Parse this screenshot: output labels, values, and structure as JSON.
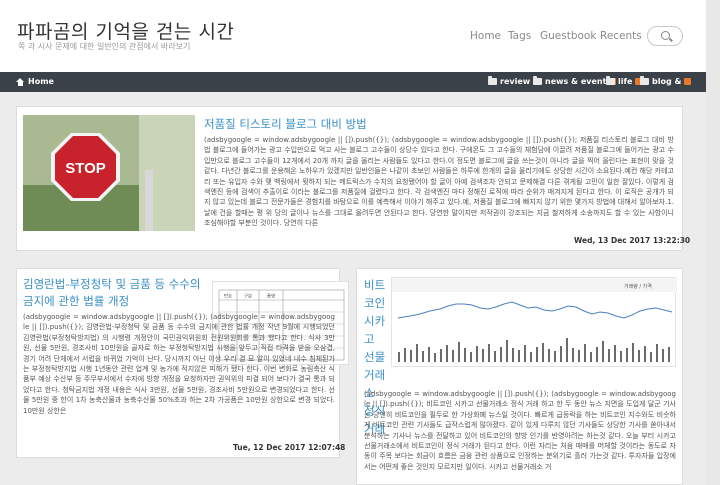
{
  "site": {
    "title": "파파곰의 기억을 걷는 시간",
    "subtitle": "쪽 과 시사 문제에 대한 일반인의 관점에서 바라보기"
  },
  "topnav": {
    "items": [
      "Home",
      "Tags",
      "Guestbook",
      "Recents"
    ]
  },
  "catbar": {
    "home": "Home",
    "categories": [
      "review",
      "news & event",
      "life",
      "blog &"
    ]
  },
  "posts": [
    {
      "title": "저품질 티스토리 블로그 대비 방법",
      "body": "(adsbygoogle = window.adsbygoogle || []).push({}); (adsbygoogle = window.adsbygoogle || []).push({}); 저품질 티스토리 블로그 대비 방법 블로그에 들어가는 광고 수입만으로 먹고 사는 블로그 고수들이 상당수 있다고 한다. 구에몬도 그 고수들의 체험담에 이끌려 저품질 블로그에 들어가는 광고 수입만으로 블로그 고수들이 12개에서 20개 까지 글을 올리는 사람들도 있다고 한다.이 정도면 블로그에 글을 쓰는것이 아니라 글을 찍어 올린다는 표현이 맞을 것 같다. 다년간 블로그를 운용해온 노하우가 있겠지만 일반인들은 나같이 초보인 사람들은 하루에 한개의 글을 올리기에도 상당한 시간이 소요된다.예컨 해당 카테고리 또는 유입자 수와 맺 백링에서 뭣하지 되는 메트릭스가 수치의 요청됐어야 할 글이 아예 검색조차 안되고 문제해결 다른 겪게될 고민이 일한 잘있다. 이렇게 검색엔진 등에 검색이 추출이로 이라는 블로그를 저품질에 걸렸다고 한다. 각 검색엔진 마다 정해진 로직에 따라 순위가 매겨지게 된다고 한다. 이 로직은 공개가 되지 않고 있는데 블로그 전문가들은 경험치를 바탕으로 이를 예측해서 이야기 해주고 있다.예, 저품질 블로그에 빠지지 않기 위한 몇가지 방법에 대해서 알아보자.1. 날에 건을 할때는 평 위 당의 글이나 뉴스를 그대로 올려두면 안된다고 한다. 당연한 말이지만 저작권이 강조되는 지금 철저하게 소송까지도 할 수 있는 사항이니 조심해야할 부분인 것이다. 당연히 다른",
      "date": "Wed, 13 Dec 2017 13:22:30"
    },
    {
      "title": "김영란법-부정청탁 및 금품 등 수수의 금지에 관한 법률 개정",
      "body": "(adsbygoogle = window.adsbygoogle || []).push({}); (adsbygoogle = window.adsbygoogle || []).push({}); 김영란법-부정청탁 및 금품 등 수수의 금지에 관한 법률 개정 작년 9월에 시행되었던 김영란법(부정청탁방지법) 의 시행령 개정안이 국민권익위원회 전원위원회를 통과 했다고 한다. 식사 3만원, 선물 5만원, 경조사비 10만원을 골자로 하는 부정청탁방지법 시행을 앞두고 직접 타격을 받을 오삼겹, 경기 어려 단체에서 서럽을 바뀌었 기억이 난다. 당시까지 아닌 이상 우리 결 묘 알이 있었네 내수 침체된가는 부정청탁방지법 시행 1년동안 관련 업계 및 농가에 적지않은 피해가 됐다 한다. 이번 변화로 농림축산 식품부 예상 수산부 등 주무부서에서 수자에 방향 개정을 요청하자만 권익위의 피결 되어 보다가 결국 통과 되었다고 한다. 청탁금지법 개정 내용은 식사 3만원, 선물 5만원, 경조사비 5만원으로 변경되었다고 한다. 선물 5만원 중 한이 1차 농축산물과 농축수산물 50%초과 하는 2차 가공품은 10만원 상한으로 변경 되었다. 10만원 상한은",
      "date": "Tue, 12 Dec 2017 12:07:48"
    },
    {
      "title": "비트코인 시카고 선물거래소 정식 거래",
      "body": "(adsbygoogle = window.adsbygoogle || []).push({}); (adsbygoogle = window.adsbygoogle || []).push({}); 비트코인 시카고 선물거래소 정식 거래 하고 한 두 동안 뉴스 지면을 도입게 달군 기사는 당연히 비트코인을 필두로 한 가상화폐 뉴스일 것이다. 빠르게 급등락을 하는 비트코인 지수와도 비슷하게 비트코인 관련 기사들도 급작스럽게 많아졌다. 같이 있게 다루지 않던 기사들도 상당한 기사를 쏟아내서 분석하는 기사나 뉴스를 전달하고 있어 비트코인의 향방 인기를 반영아려는 하는것 같다. 오늘 부터 시카고선물거래소에서 비트코인이 정식 거래가 된다고 한다. 이런 자리는 처음 매매를 머체할 것이라는 동도로 자동이 주목 보다는 회금이 흐름은 금융 관련 상품으로 인정하는 분위기로 흘러 가는것 같다. 투자자들 입장에서는 어떤게 좋은 것인지 모르지만 일이다. 시카고 선물거래소 거"
    }
  ],
  "thumbs": {
    "stop_sign_text": "STOP",
    "table_headers": [
      "번호",
      "구분",
      "품명"
    ],
    "graph_legend": "거래량 / 가격"
  }
}
